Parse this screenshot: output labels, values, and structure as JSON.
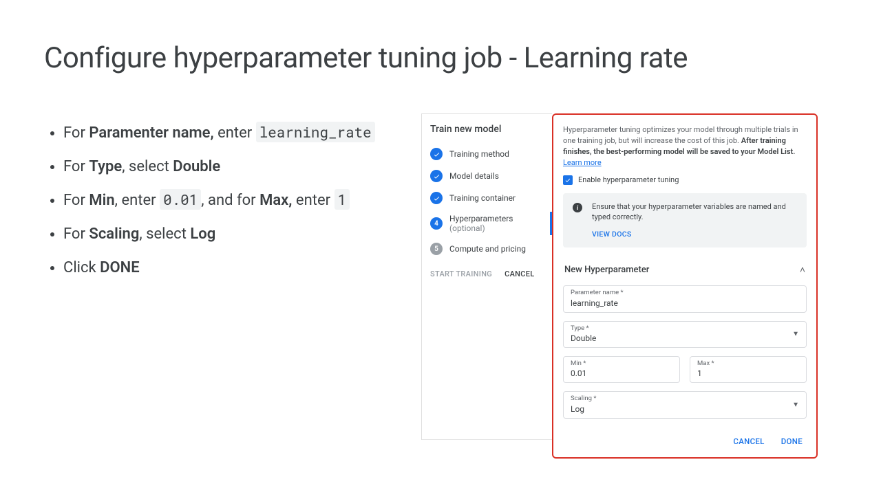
{
  "title": "Configure hyperparameter tuning job - Learning rate",
  "bullets": {
    "b1_pre": "For ",
    "b1_bold": "Paramenter name,",
    "b1_mid": " enter ",
    "b1_code": "learning_rate",
    "b2_pre": "For ",
    "b2_bold": "Type",
    "b2_mid": ", select ",
    "b2_bold2": "Double",
    "b3_pre": "For ",
    "b3_bold": "Min",
    "b3_mid": ", enter ",
    "b3_code": "0.01",
    "b3_mid2": ", and for ",
    "b3_bold2": "Max,",
    "b3_mid3": " enter ",
    "b3_code2": "1",
    "b4_pre": "For ",
    "b4_bold": "Scaling",
    "b4_mid": ", select ",
    "b4_bold2": "Log",
    "b5_pre": "Click ",
    "b5_bold": "DONE"
  },
  "stepper": {
    "title": "Train new model",
    "s1": "Training method",
    "s2": "Model details",
    "s3": "Training container",
    "s4": "Hyperparameters",
    "s4_opt": " (optional)",
    "s4_num": "4",
    "s5": "Compute and pricing",
    "s5_num": "5",
    "start": "START TRAINING",
    "cancel": "CANCEL"
  },
  "form": {
    "desc_p1": "Hyperparameter tuning optimizes your model through multiple trials in one training job, but will increase the cost of this job. ",
    "desc_bold": "After training finishes, the best-performing model will be saved to your Model List.",
    "desc_link": "Learn more",
    "checkbox_label": "Enable hyperparameter tuning",
    "info_text": "Ensure that your hyperparameter variables are named and typed correctly.",
    "view_docs": "VIEW DOCS",
    "section": "New Hyperparameter",
    "param_label": "Parameter name *",
    "param_value": "learning_rate",
    "type_label": "Type *",
    "type_value": "Double",
    "min_label": "Min *",
    "min_value": "0.01",
    "max_label": "Max *",
    "max_value": "1",
    "scaling_label": "Scaling *",
    "scaling_value": "Log",
    "cancel": "CANCEL",
    "done": "DONE"
  }
}
